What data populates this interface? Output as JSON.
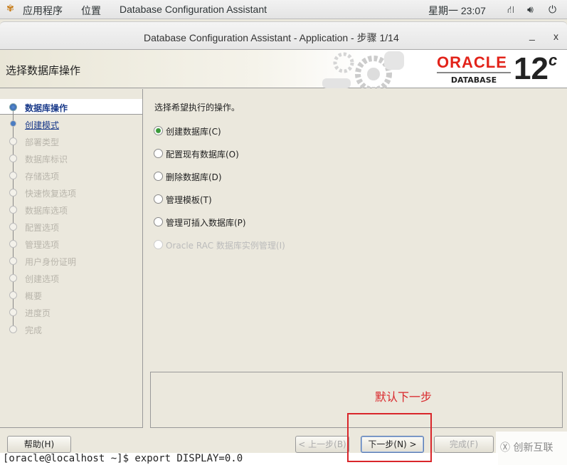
{
  "topbar": {
    "apps": "应用程序",
    "places": "位置",
    "app_name": "Database Configuration Assistant",
    "clock": "星期一 23:07"
  },
  "window": {
    "title": "Database Configuration Assistant - Application - 步骤 1/14",
    "minimize": "_",
    "close": "x"
  },
  "header": {
    "title": "选择数据库操作",
    "logo_oracle": "ORACLE",
    "logo_database": "DATABASE",
    "logo_version": "12",
    "logo_suffix": "c"
  },
  "steps": [
    {
      "label": "数据库操作",
      "state": "current"
    },
    {
      "label": "创建模式",
      "state": "link"
    },
    {
      "label": "部署类型",
      "state": "disabled"
    },
    {
      "label": "数据库标识",
      "state": "disabled"
    },
    {
      "label": "存储选项",
      "state": "disabled"
    },
    {
      "label": "快速恢复选项",
      "state": "disabled"
    },
    {
      "label": "数据库选项",
      "state": "disabled"
    },
    {
      "label": "配置选项",
      "state": "disabled"
    },
    {
      "label": "管理选项",
      "state": "disabled"
    },
    {
      "label": "用户身份证明",
      "state": "disabled"
    },
    {
      "label": "创建选项",
      "state": "disabled"
    },
    {
      "label": "概要",
      "state": "disabled"
    },
    {
      "label": "进度页",
      "state": "disabled"
    },
    {
      "label": "完成",
      "state": "disabled"
    }
  ],
  "main": {
    "prompt": "选择希望执行的操作。",
    "options": [
      {
        "label": "创建数据库(C)",
        "selected": true,
        "enabled": true
      },
      {
        "label": "配置现有数据库(O)",
        "selected": false,
        "enabled": true
      },
      {
        "label": "删除数据库(D)",
        "selected": false,
        "enabled": true
      },
      {
        "label": "管理模板(T)",
        "selected": false,
        "enabled": true
      },
      {
        "label": "管理可插入数据库(P)",
        "selected": false,
        "enabled": true
      },
      {
        "label": "Oracle RAC 数据库实例管理(I)",
        "selected": false,
        "enabled": false
      }
    ]
  },
  "annotation": "默认下一步",
  "buttons": {
    "help": "帮助(H)",
    "back": "< 上一步(B)",
    "next": "下一步(N) >",
    "finish": "完成(F)"
  },
  "terminal": "[oracle@localhost ~]$ export DISPLAY=0.0",
  "watermark": "创新互联",
  "colors": {
    "accent": "#1a3a8a",
    "oracle_red": "#e2231a",
    "annotation": "#d9262a"
  }
}
